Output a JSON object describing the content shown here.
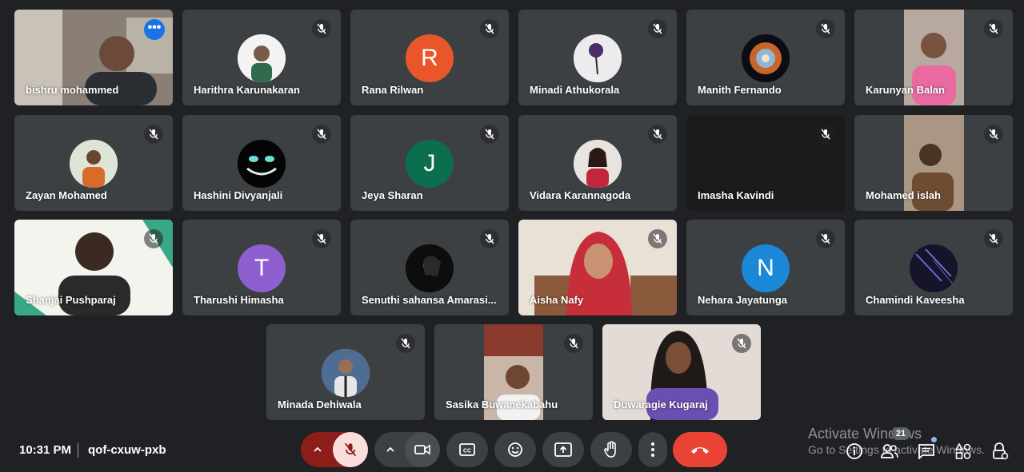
{
  "participants": [
    {
      "name": "bishru mohammed"
    },
    {
      "name": "Harithra Karunakaran"
    },
    {
      "name": "Rana Rilwan",
      "initial": "R",
      "color": "#e8562a"
    },
    {
      "name": "Minadi Athukorala"
    },
    {
      "name": "Manith Fernando"
    },
    {
      "name": "Karunyan Balan"
    },
    {
      "name": "Zayan Mohamed"
    },
    {
      "name": "Hashini Divyanjali"
    },
    {
      "name": "Jeya Sharan",
      "initial": "J",
      "color": "#0b6e4f"
    },
    {
      "name": "Vidara Karannagoda"
    },
    {
      "name": "Imasha Kavindi"
    },
    {
      "name": "Mohamed islah"
    },
    {
      "name": "Shanjai Pushparaj"
    },
    {
      "name": "Tharushi Himasha",
      "initial": "T",
      "color": "#8e5fcf"
    },
    {
      "name": "Senuthi sahansa Amarasi..."
    },
    {
      "name": "Aisha Nafy"
    },
    {
      "name": "Nehara Jayatunga",
      "initial": "N",
      "color": "#1a88d6"
    },
    {
      "name": "Chamindi Kaveesha"
    },
    {
      "name": "Minada Dehiwala"
    },
    {
      "name": "Sasika Buwanekabahu"
    },
    {
      "name": "Duwaragie Kugaraj"
    }
  ],
  "tile_more_label": "•••",
  "meeting": {
    "time": "10:31 PM",
    "separator": "|",
    "code": "qof-cxuw-pxb"
  },
  "participants_count": "21",
  "watermark": {
    "line1": "Activate Windows",
    "line2": "Go to Settings to activate Windows."
  },
  "colors": {
    "background": "#202124",
    "tile": "#3c4043",
    "end_call": "#ea4335",
    "mic_off": "#f9dedc",
    "active_outline": "#8ab4f8"
  },
  "icons": [
    "mic-off-icon",
    "chevron-up-icon",
    "camera-icon",
    "captions-icon",
    "emoji-icon",
    "present-icon",
    "raise-hand-icon",
    "more-vert-icon",
    "call-end-icon",
    "info-icon",
    "people-icon",
    "chat-icon",
    "activities-icon",
    "host-controls-icon"
  ]
}
